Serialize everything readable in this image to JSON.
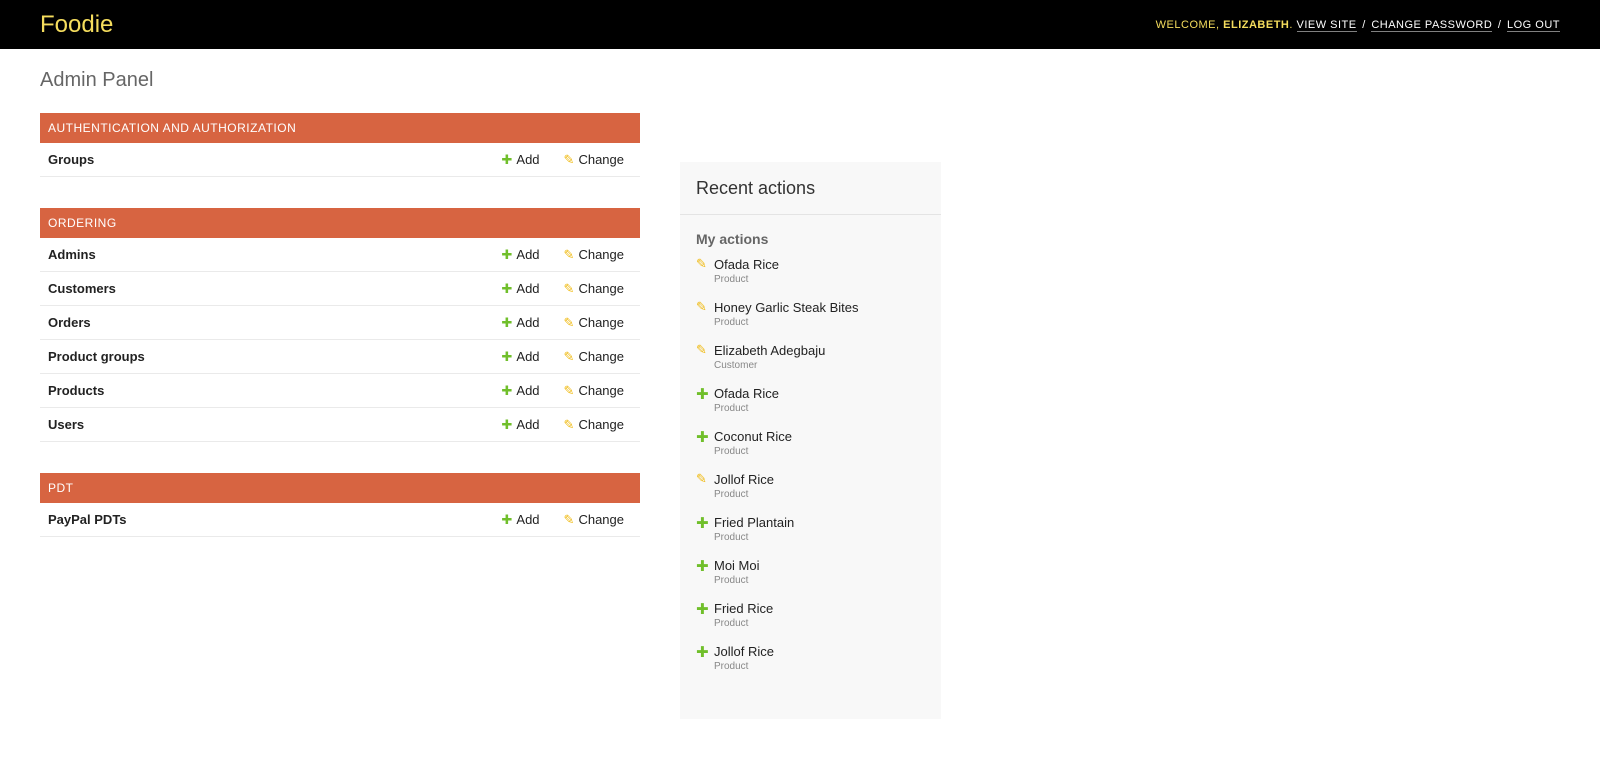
{
  "header": {
    "brand": "Foodie",
    "welcome": "WELCOME,",
    "username": "ELIZABETH",
    "view_site": "VIEW SITE",
    "change_password": "CHANGE PASSWORD",
    "log_out": "LOG OUT"
  },
  "page": {
    "title": "Admin Panel"
  },
  "labels": {
    "add": "Add",
    "change": "Change"
  },
  "modules": [
    {
      "caption": "AUTHENTICATION AND AUTHORIZATION",
      "models": [
        "Groups"
      ]
    },
    {
      "caption": "ORDERING",
      "models": [
        "Admins",
        "Customers",
        "Orders",
        "Product groups",
        "Products",
        "Users"
      ]
    },
    {
      "caption": "PDT",
      "models": [
        "PayPal PDTs"
      ]
    }
  ],
  "recent": {
    "title": "Recent actions",
    "subtitle": "My actions",
    "items": [
      {
        "name": "Ofada Rice",
        "type": "Product",
        "icon": "pencil-icon"
      },
      {
        "name": "Honey Garlic Steak Bites",
        "type": "Product",
        "icon": "pencil-icon"
      },
      {
        "name": "Elizabeth Adegbaju",
        "type": "Customer",
        "icon": "pencil-icon"
      },
      {
        "name": "Ofada Rice",
        "type": "Product",
        "icon": "plus-icon"
      },
      {
        "name": "Coconut Rice",
        "type": "Product",
        "icon": "plus-icon"
      },
      {
        "name": "Jollof Rice",
        "type": "Product",
        "icon": "pencil-icon"
      },
      {
        "name": "Fried Plantain",
        "type": "Product",
        "icon": "plus-icon"
      },
      {
        "name": "Moi Moi",
        "type": "Product",
        "icon": "plus-icon"
      },
      {
        "name": "Fried Rice",
        "type": "Product",
        "icon": "plus-icon"
      },
      {
        "name": "Jollof Rice",
        "type": "Product",
        "icon": "plus-icon"
      }
    ]
  },
  "colors": {
    "header_bg": "#000000",
    "brand": "#f5dd5d",
    "module_caption": "#d76441",
    "add_icon": "#70bf2b",
    "change_icon": "#efb80b"
  }
}
